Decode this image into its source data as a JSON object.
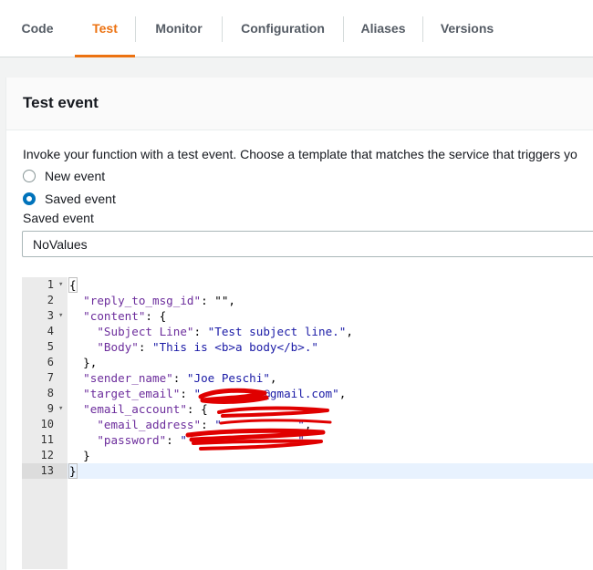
{
  "tabs": [
    {
      "label": "Code",
      "active": false
    },
    {
      "label": "Test",
      "active": true
    },
    {
      "label": "Monitor",
      "active": false
    },
    {
      "label": "Configuration",
      "active": false
    },
    {
      "label": "Aliases",
      "active": false
    },
    {
      "label": "Versions",
      "active": false
    }
  ],
  "panel": {
    "title": "Test event",
    "description": "Invoke your function with a test event. Choose a template that matches the service that triggers yo",
    "radios": [
      {
        "label": "New event",
        "checked": false
      },
      {
        "label": "Saved event",
        "checked": true
      }
    ],
    "saved_event_label": "Saved event",
    "saved_event_value": "NoValues"
  },
  "editor": {
    "lines": [
      {
        "num": "1",
        "fold": "▾"
      },
      {
        "num": "2",
        "fold": ""
      },
      {
        "num": "3",
        "fold": "▾"
      },
      {
        "num": "4",
        "fold": ""
      },
      {
        "num": "5",
        "fold": ""
      },
      {
        "num": "6",
        "fold": ""
      },
      {
        "num": "7",
        "fold": ""
      },
      {
        "num": "8",
        "fold": ""
      },
      {
        "num": "9",
        "fold": "▾"
      },
      {
        "num": "10",
        "fold": ""
      },
      {
        "num": "11",
        "fold": ""
      },
      {
        "num": "12",
        "fold": ""
      },
      {
        "num": "13",
        "fold": ""
      }
    ],
    "code": {
      "l1_open": "{",
      "l2_key": "\"reply_to_msg_id\"",
      "l2_rest": ": \"\",",
      "l3_key": "\"content\"",
      "l3_rest": ": {",
      "l4_key": "\"Subject Line\"",
      "l4_colon": ": ",
      "l4_val": "\"Test subject line.\"",
      "l4_end": ",",
      "l5_key": "\"Body\"",
      "l5_colon": ": ",
      "l5_val": "\"This is <b>a body</b>.\"",
      "l6": "},",
      "l7_key": "\"sender_name\"",
      "l7_colon": ": ",
      "l7_val": "\"Joe Peschi\"",
      "l7_end": ",",
      "l8_key": "\"target_email\"",
      "l8_colon": ": ",
      "l8_val": "\"         @gmail.com\"",
      "l8_end": ",",
      "l9_key": "\"email_account\"",
      "l9_rest": ": {",
      "l10_key": "\"email_address\"",
      "l10_colon": ": ",
      "l10_val": "\"           \"",
      "l10_end": ",",
      "l11_key": "\"password\"",
      "l11_colon": ": ",
      "l11_val": "\"                \"",
      "l12": "}",
      "l13_close": "}"
    }
  },
  "colors": {
    "accent": "#ec7211",
    "radio_selected": "#0073bb",
    "json_key": "#6c2d9c",
    "json_string": "#1a1aa6",
    "redaction": "#e00000"
  }
}
